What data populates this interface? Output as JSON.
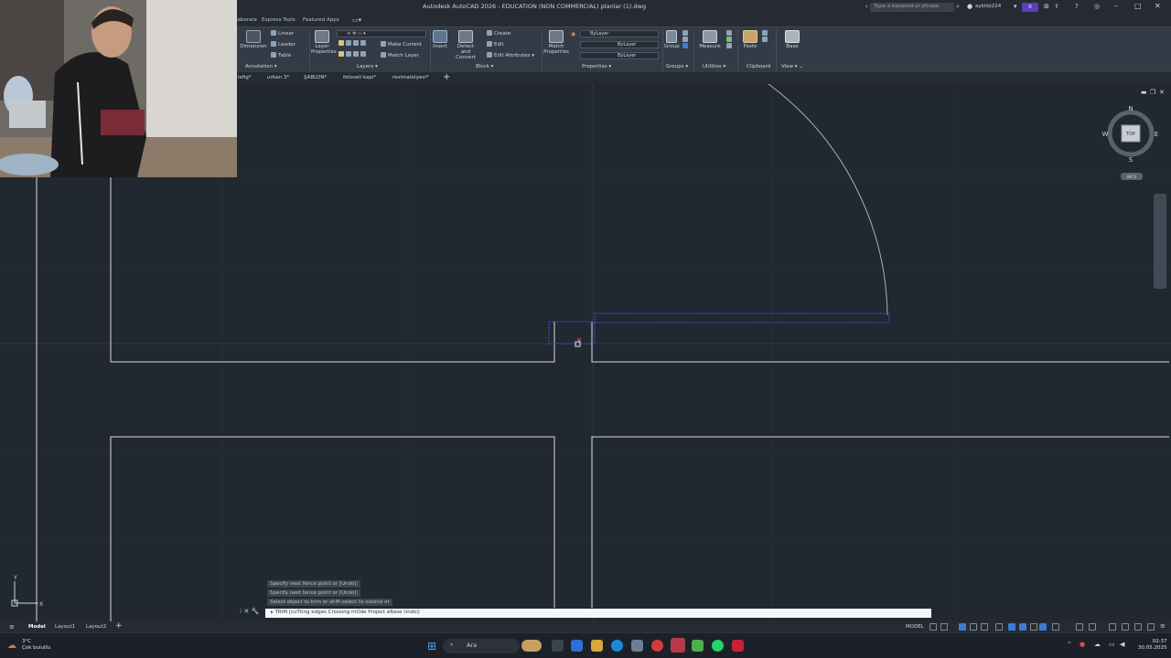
{
  "window": {
    "title": "Autodesk AutoCAD 2026 - EDUCATION (NON COMMERCIAL)   planlar (1).dwg",
    "search_placeholder": "Type a keyword or phrase",
    "user": "aykldz224",
    "notification_badge": "0"
  },
  "ribbon_tabs": [
    "laborate",
    "Express Tools",
    "Featured Apps"
  ],
  "ribbon": {
    "annotation": {
      "dimension": "Dimension",
      "linear": "Linear",
      "leader": "Leader",
      "table": "Table",
      "group": "Annotation"
    },
    "layers": {
      "layer_properties": "Layer Properties",
      "make_current": "Make Current",
      "match_layer": "Match Layer",
      "group": "Layers"
    },
    "block": {
      "insert": "Insert",
      "detect_convert": "Detect and Convert",
      "create": "Create",
      "edit": "Edit",
      "edit_attributes": "Edit Attributes",
      "group": "Block"
    },
    "properties": {
      "match_properties": "Match Properties",
      "color": "ByLayer",
      "linetype": "ByLayer",
      "lineweight": "ByLayer",
      "group": "Properties"
    },
    "groups": {
      "group_btn": "Group",
      "group": "Groups"
    },
    "utilities": {
      "measure": "Measure",
      "group": "Utilities"
    },
    "clipboard": {
      "paste": "Paste",
      "group": "Clipboard"
    },
    "view": {
      "base": "Base",
      "group": "View"
    }
  },
  "file_tabs": [
    "lefig*",
    "urban 3*",
    "ŞABLON*",
    "fotoseli kapı*",
    "resimatolyesi*"
  ],
  "viewcube": {
    "north": "N",
    "south": "S",
    "east": "E",
    "west": "W",
    "face": "TOP",
    "wcs": "WCS"
  },
  "ucs": {
    "x": "X",
    "y": "Y"
  },
  "command": {
    "history": [
      "Specify next fence point or [Undo]:",
      "Specify next fence point or [Undo]:",
      "Select object to trim or shift-select to extend or"
    ],
    "current": "TRIM  [cuTting edges Crossing mOde Project eRase Undo]:"
  },
  "layout_tabs": [
    "Model",
    "Layout1",
    "Layout2"
  ],
  "status": {
    "model": "MODEL"
  },
  "taskbar": {
    "weather_temp": "3°C",
    "weather_desc": "Çok bulutlu",
    "search": "Ara",
    "time": "02:37",
    "date": "30.05.2025"
  },
  "colors": {
    "canvas": "#212830",
    "ribbon": "#333b46",
    "accent": "#3d7bd1",
    "selection": "#3b4fd6"
  }
}
